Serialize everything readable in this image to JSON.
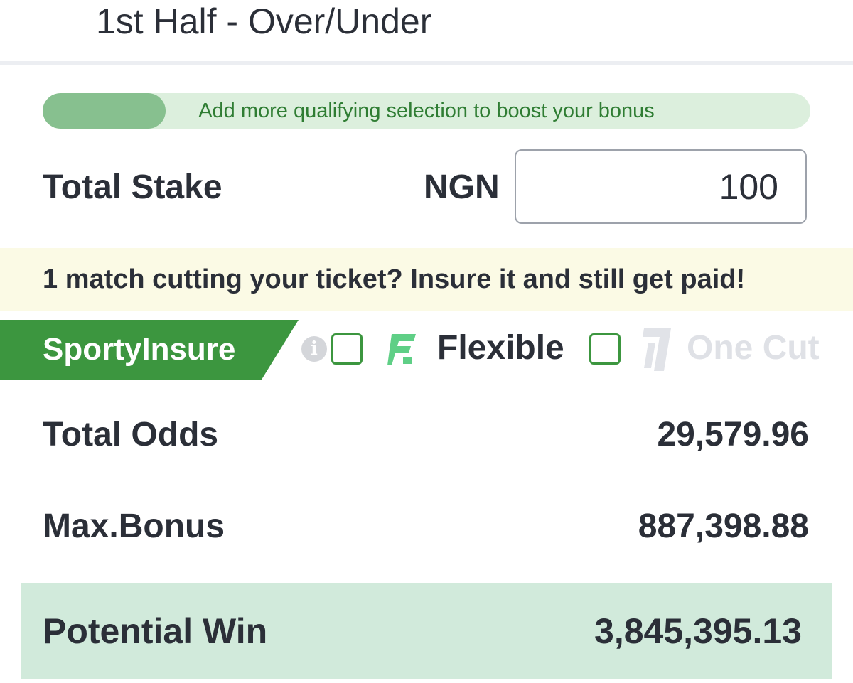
{
  "header": {
    "market_title": "1st Half - Over/Under"
  },
  "bonus_progress": {
    "message": "Add more qualifying selection to boost your bonus",
    "progress_fraction": 0.16
  },
  "stake": {
    "label": "Total Stake",
    "currency": "NGN",
    "value": "100"
  },
  "insurance": {
    "banner": "1 match cutting your ticket? Insure it and still get paid!",
    "tag": "SportyInsure",
    "info_icon": "info-icon",
    "options": [
      {
        "label": "Flexible",
        "checked": false,
        "icon": "flexible-f-icon",
        "enabled": true
      },
      {
        "label": "One Cut",
        "checked": false,
        "icon": "one-cut-icon",
        "enabled": false
      }
    ]
  },
  "summary": {
    "total_odds_label": "Total Odds",
    "total_odds_value": "29,579.96",
    "max_bonus_label": "Max.Bonus",
    "max_bonus_value": "887,398.88",
    "potential_win_label": "Potential Win",
    "potential_win_value": "3,845,395.13"
  },
  "colors": {
    "brand_green": "#3c963f",
    "progress_track": "#dcefdd",
    "progress_fill": "#87c08f",
    "banner_bg": "#fbfae5",
    "win_bg": "#d1eadb",
    "text": "#2b2f38",
    "disabled_text": "#dfe1e6"
  }
}
